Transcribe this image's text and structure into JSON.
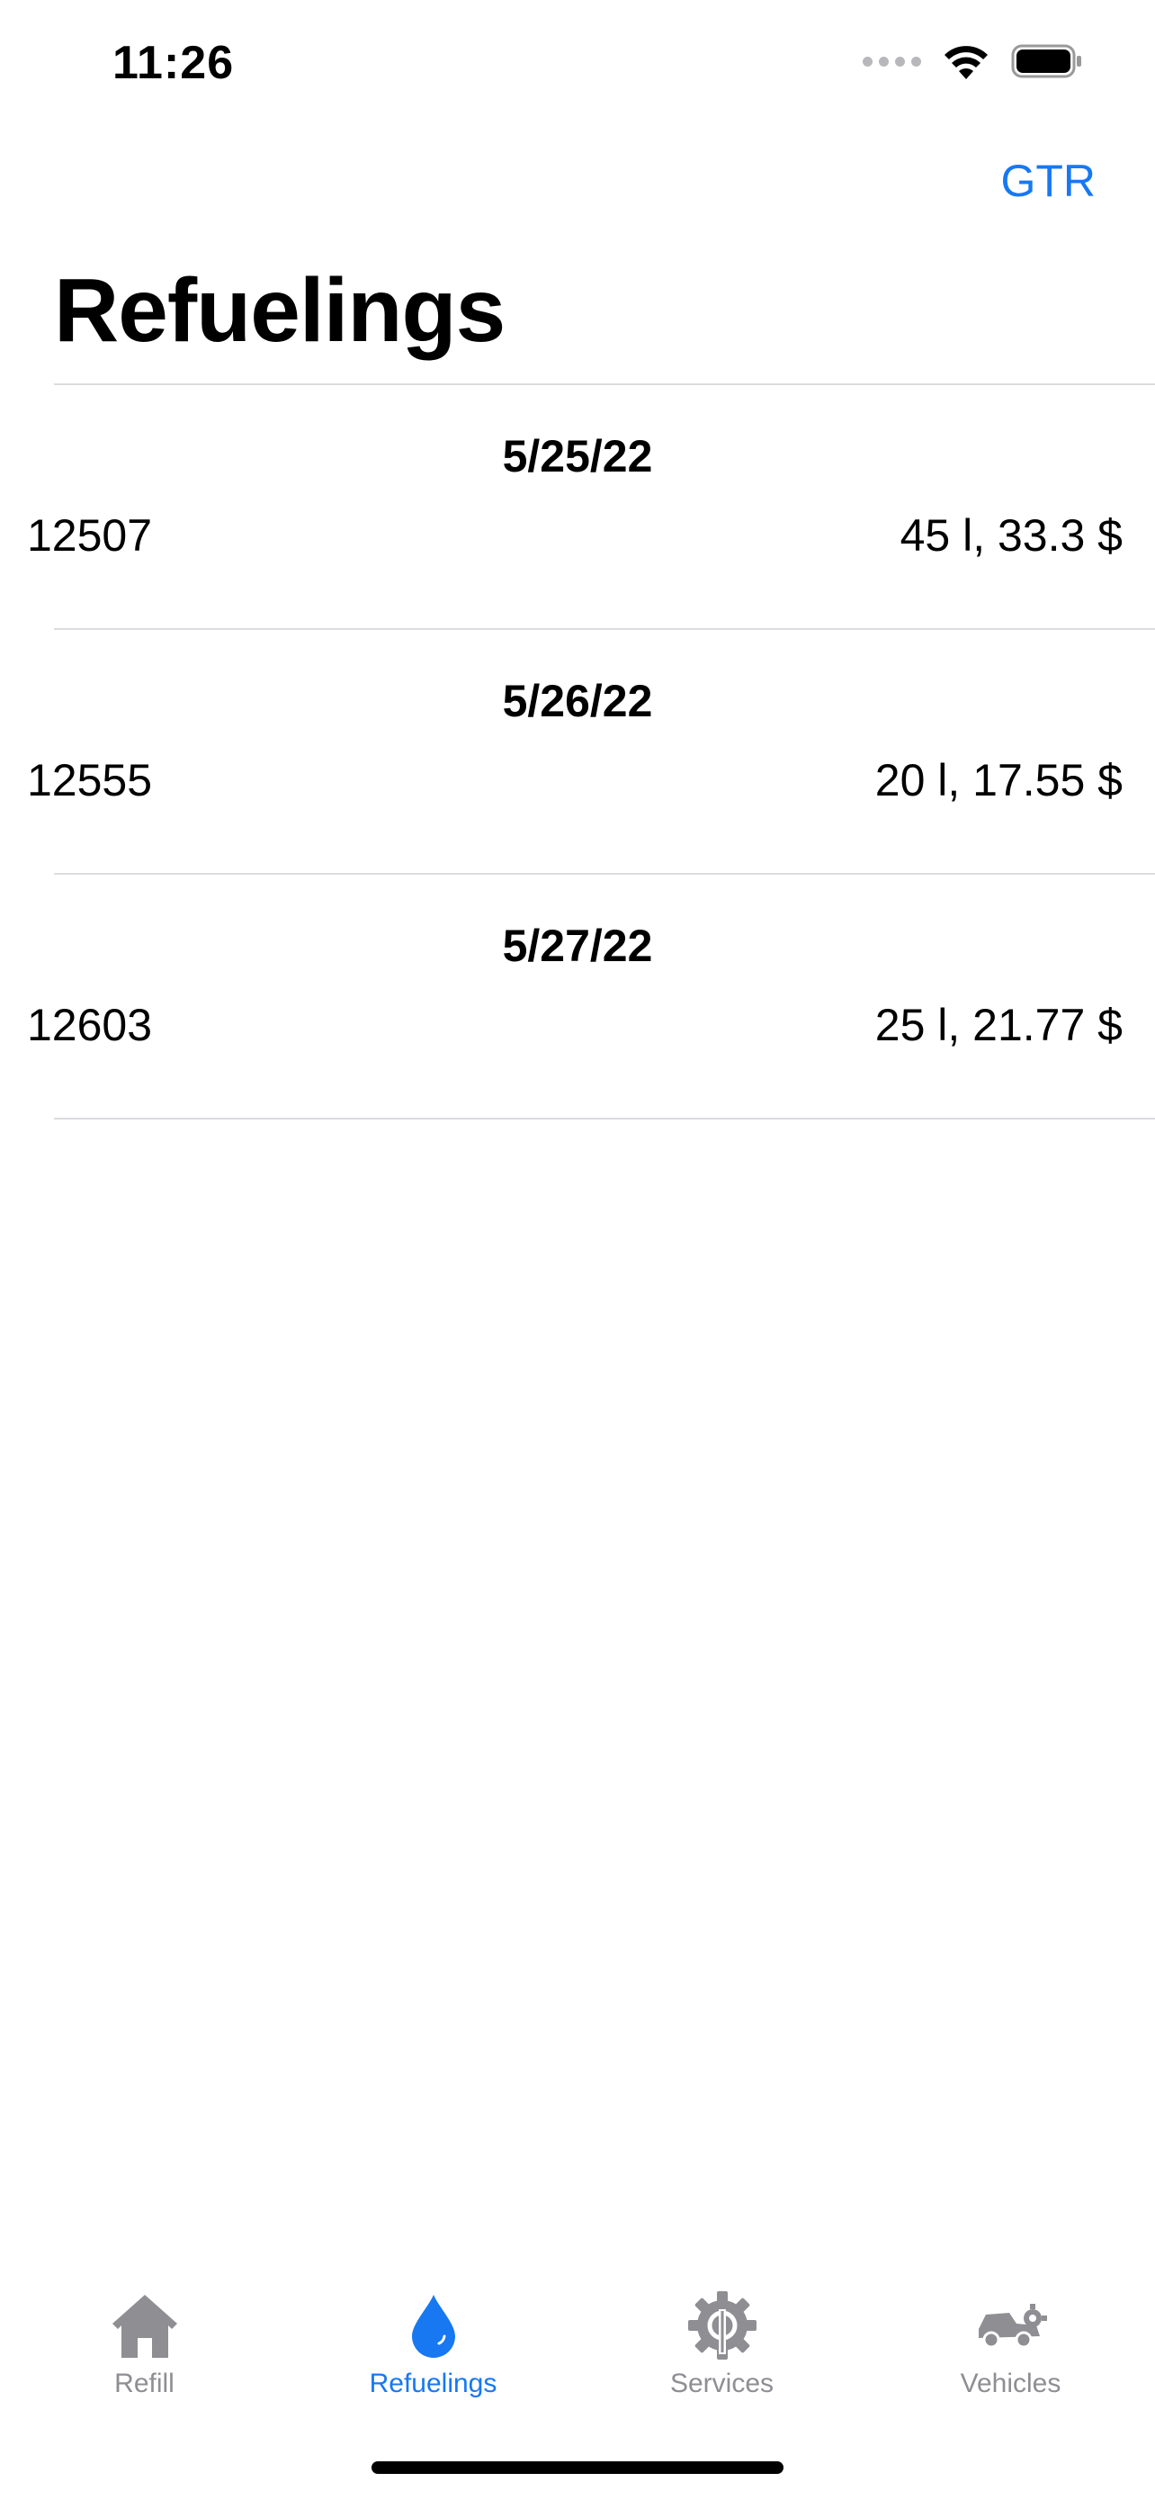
{
  "status_bar": {
    "time": "11:26"
  },
  "nav": {
    "action_label": "GTR",
    "title": "Refuelings"
  },
  "refuelings": [
    {
      "date": "5/25/22",
      "odometer": "12507",
      "summary": "45 l, 33.3 $"
    },
    {
      "date": "5/26/22",
      "odometer": "12555",
      "summary": "20 l, 17.55 $"
    },
    {
      "date": "5/27/22",
      "odometer": "12603",
      "summary": "25 l, 21.77 $"
    }
  ],
  "tab_bar": {
    "items": [
      {
        "label": "Refill",
        "icon": "house-icon",
        "active": false
      },
      {
        "label": "Refuelings",
        "icon": "drop-icon",
        "active": true
      },
      {
        "label": "Services",
        "icon": "gear-wrench-icon",
        "active": false
      },
      {
        "label": "Vehicles",
        "icon": "car-icon",
        "active": false
      }
    ]
  },
  "colors": {
    "accent": "#1778f2",
    "inactive": "#8e8e93",
    "separator": "#dcdce0"
  }
}
